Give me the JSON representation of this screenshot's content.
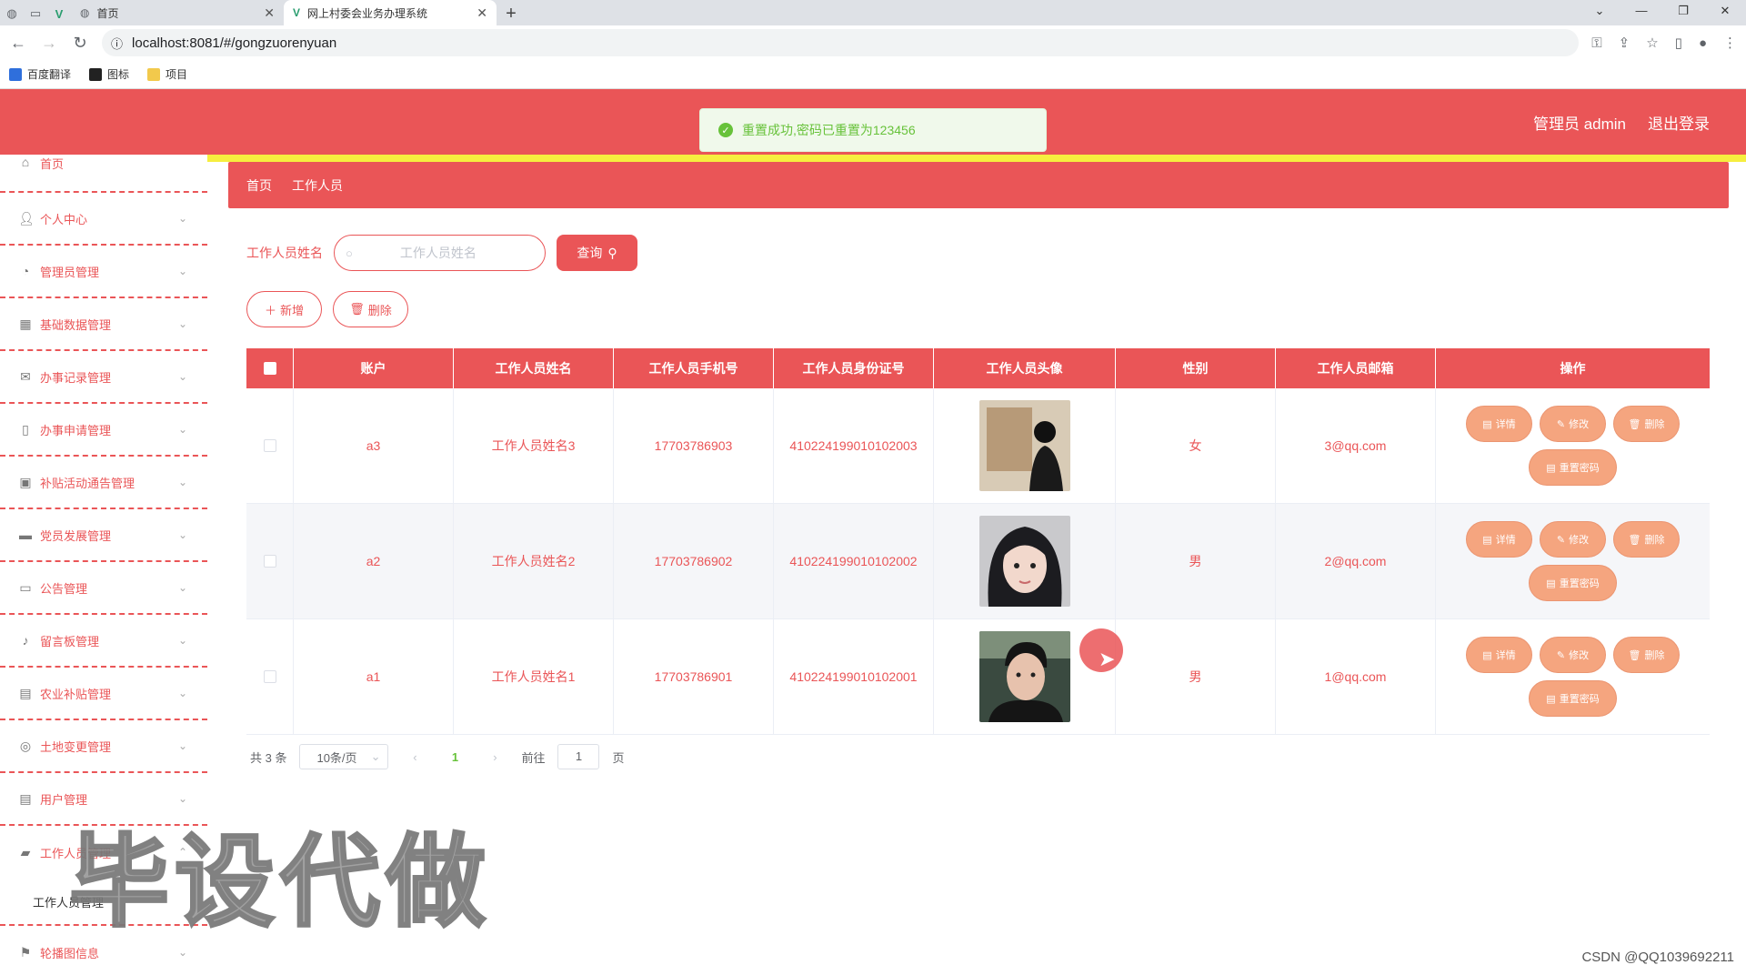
{
  "browser": {
    "tabs": [
      {
        "title": "首页",
        "active": false
      },
      {
        "title": "网上村委会业务办理系统",
        "active": true
      }
    ],
    "url": "localhost:8081/#/gongzuorenyuan",
    "bookmarks": [
      "百度翻译",
      "图标",
      "项目"
    ]
  },
  "header": {
    "toast": "重置成功,密码已重置为123456",
    "user": "管理员 admin",
    "logout": "退出登录"
  },
  "sidebar": {
    "items": [
      {
        "label": "首页",
        "icon": "home-icon"
      },
      {
        "label": "个人中心",
        "icon": "user-icon"
      },
      {
        "label": "管理员管理",
        "icon": "gauge-icon"
      },
      {
        "label": "基础数据管理",
        "icon": "grid-icon"
      },
      {
        "label": "办事记录管理",
        "icon": "mail-icon"
      },
      {
        "label": "办事申请管理",
        "icon": "mic-icon"
      },
      {
        "label": "补贴活动通告管理",
        "icon": "clipboard-icon"
      },
      {
        "label": "党员发展管理",
        "icon": "monitor-icon"
      },
      {
        "label": "公告管理",
        "icon": "chat-icon"
      },
      {
        "label": "留言板管理",
        "icon": "bell-icon"
      },
      {
        "label": "农业补贴管理",
        "icon": "doc-icon"
      },
      {
        "label": "土地变更管理",
        "icon": "circle-icon"
      },
      {
        "label": "用户管理",
        "icon": "list-icon"
      },
      {
        "label": "工作人员管理",
        "icon": "ticket-icon"
      }
    ],
    "sub_item": "工作人员管理",
    "last_item": "轮播图信息"
  },
  "breadcrumb": {
    "home": "首页",
    "current": "工作人员"
  },
  "search": {
    "label": "工作人员姓名",
    "placeholder": "工作人员姓名",
    "button": "查询"
  },
  "actions": {
    "add": "新增",
    "delete": "删除"
  },
  "table": {
    "headers": [
      "账户",
      "工作人员姓名",
      "工作人员手机号",
      "工作人员身份证号",
      "工作人员头像",
      "性别",
      "工作人员邮箱",
      "操作"
    ],
    "rows": [
      {
        "account": "a3",
        "name": "工作人员姓名3",
        "phone": "17703786903",
        "idcard": "410224199010102003",
        "gender": "女",
        "email": "3@qq.com"
      },
      {
        "account": "a2",
        "name": "工作人员姓名2",
        "phone": "17703786902",
        "idcard": "410224199010102002",
        "gender": "男",
        "email": "2@qq.com"
      },
      {
        "account": "a1",
        "name": "工作人员姓名1",
        "phone": "17703786901",
        "idcard": "410224199010102001",
        "gender": "男",
        "email": "1@qq.com"
      }
    ],
    "ops": {
      "detail": "详情",
      "edit": "修改",
      "delete": "删除",
      "reset": "重置密码"
    }
  },
  "pager": {
    "total": "共 3 条",
    "size": "10条/页",
    "page": "1",
    "goto": "前往",
    "goto_value": "1",
    "page_unit": "页"
  },
  "watermark": "毕设代做",
  "credit": "CSDN @QQ1039692211",
  "colors": {
    "primary": "#ea5557",
    "stripe": "#f6ee3f",
    "op_button": "#f5a57f",
    "toast_bg": "#f0f9eb"
  }
}
